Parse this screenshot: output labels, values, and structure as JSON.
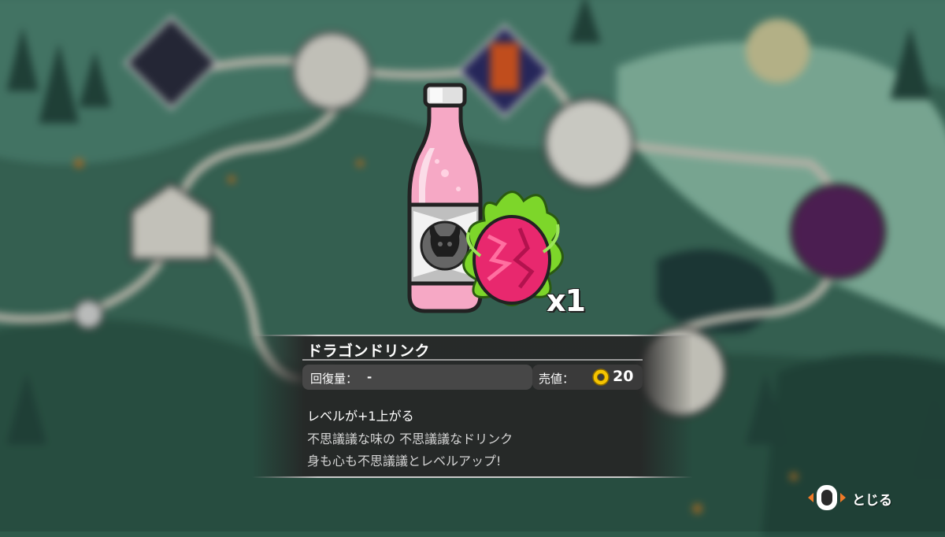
{
  "item": {
    "name": "ドラゴンドリンク",
    "quantity": "x1",
    "recovery_label": "回復量：",
    "recovery_value": "-",
    "price_label": "売値：",
    "price_value": "20",
    "effect": "レベルが+1上がる",
    "description": [
      "不思議議な味の 不思議議なドリンク",
      "身も心も不思議議とレベルアップ!"
    ],
    "icon": "dragon-drink-bottle-icon"
  },
  "controls": {
    "close_label": "とじる",
    "close_icon": "button-prompt-icon"
  },
  "colors": {
    "panel_bg": "#262626",
    "drink_pink": "#f4a3c0",
    "dragonfruit_magenta": "#e8286e",
    "leaf_green": "#7dd62a",
    "coin_gold": "#f5c400",
    "close_accent_orange": "#f07a28"
  }
}
